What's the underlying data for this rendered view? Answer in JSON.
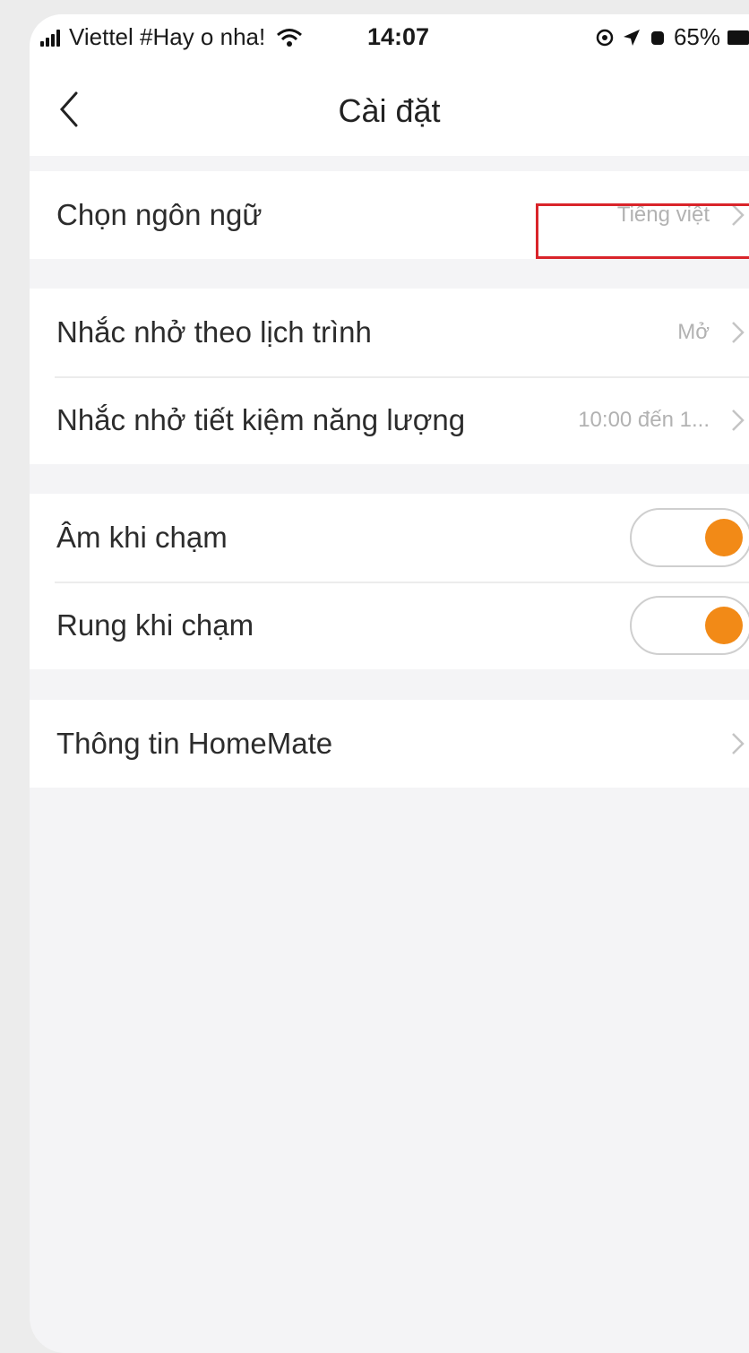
{
  "status_bar": {
    "carrier": "Viettel #Hay o nha!",
    "time": "14:07",
    "battery": "65%"
  },
  "header": {
    "title": "Cài đặt"
  },
  "settings": {
    "language": {
      "label": "Chọn ngôn ngữ",
      "value": "Tiếng việt"
    },
    "schedule_reminder": {
      "label": "Nhắc nhở theo lịch trình",
      "value": "Mở"
    },
    "energy_reminder": {
      "label": "Nhắc nhở tiết kiệm năng lượng",
      "value": "10:00 đến 1..."
    },
    "touch_sound": {
      "label": "Âm khi chạm",
      "enabled": true
    },
    "touch_vibrate": {
      "label": "Rung khi chạm",
      "enabled": true
    },
    "about": {
      "label": "Thông tin HomeMate"
    }
  },
  "colors": {
    "accent": "#f28a17",
    "highlight_border": "#d9242a"
  }
}
